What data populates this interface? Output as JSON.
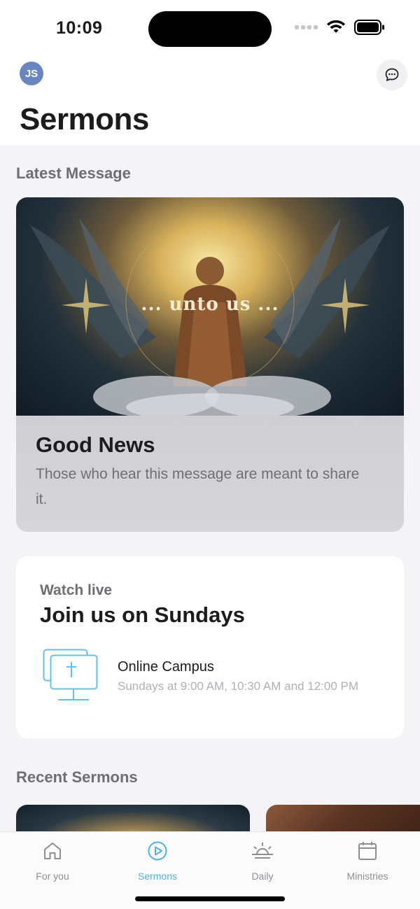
{
  "status_bar": {
    "time": "10:09"
  },
  "header": {
    "avatar_initials": "JS",
    "title": "Sermons"
  },
  "latest": {
    "section_title": "Latest Message",
    "artwork_text": "... unto us ...",
    "title": "Good News",
    "description": "Those who hear this message are meant to share it."
  },
  "watch_live": {
    "eyebrow": "Watch live",
    "heading": "Join us on Sundays",
    "campus_name": "Online Campus",
    "campus_times": "Sundays at 9:00 AM, 10:30 AM and 12:00 PM"
  },
  "recent": {
    "section_title": "Recent Sermons"
  },
  "tabs": [
    {
      "label": "For you",
      "icon": "home-icon",
      "active": false
    },
    {
      "label": "Sermons",
      "icon": "play-circle-icon",
      "active": true
    },
    {
      "label": "Daily",
      "icon": "sunrise-icon",
      "active": false
    },
    {
      "label": "Ministries",
      "icon": "calendar-icon",
      "active": false
    }
  ],
  "colors": {
    "accent": "#4fb3e0",
    "avatar_bg": "#6a86bf",
    "background": "#f4f4f7"
  }
}
